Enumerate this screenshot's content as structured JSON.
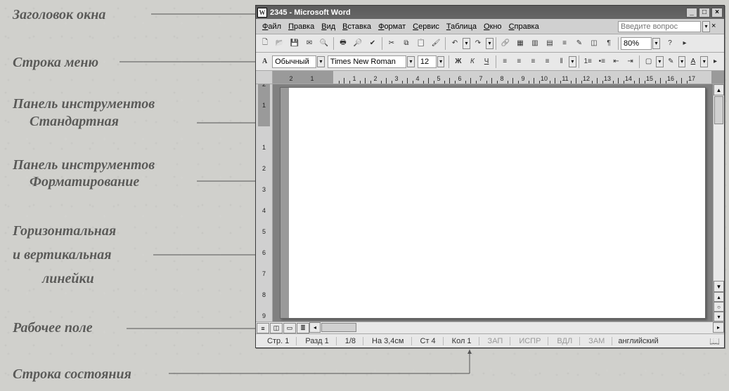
{
  "labels": {
    "title": "Заголовок окна",
    "menu": "Строка меню",
    "toolbar_std_1": "Панель инструментов",
    "toolbar_std_2": "Стандартная",
    "toolbar_fmt_1": "Панель инструментов",
    "toolbar_fmt_2": "Форматирование",
    "rulers_1": "Горизонтальная",
    "rulers_2": "и вертикальная",
    "rulers_3": "линейки",
    "workarea": "Рабочее поле",
    "status": "Строка состояния"
  },
  "window": {
    "title": "2345 - Microsoft Word",
    "app_icon_letter": "W"
  },
  "menu": {
    "items": [
      "Файл",
      "Правка",
      "Вид",
      "Вставка",
      "Формат",
      "Сервис",
      "Таблица",
      "Окно",
      "Справка"
    ],
    "ask_placeholder": "Введите вопрос"
  },
  "toolbar_std": {
    "zoom": "80%",
    "icons": [
      "new",
      "open",
      "save",
      "mail",
      "search",
      "print",
      "preview",
      "spell",
      "cut",
      "copy",
      "paste",
      "format-painter",
      "undo",
      "redo",
      "link",
      "table-border",
      "tables",
      "excel",
      "columns",
      "drawing",
      "doc-map",
      "pilcrow",
      "zoom",
      "help",
      "more"
    ]
  },
  "toolbar_fmt": {
    "mode_icon": "A",
    "style": "Обычный",
    "font": "Times New Roman",
    "size": "12",
    "bold": "Ж",
    "italic": "К",
    "underline": "Ч",
    "font_color_letter": "A"
  },
  "ruler": {
    "h_numbers": [
      "2",
      "1",
      "1",
      "2",
      "3",
      "4",
      "5",
      "6",
      "7",
      "8",
      "9",
      "10",
      "11",
      "12",
      "13",
      "14",
      "15",
      "16",
      "17"
    ],
    "v_numbers": [
      "2",
      "1",
      "1",
      "2",
      "3",
      "4",
      "5",
      "6",
      "7",
      "8"
    ]
  },
  "status": {
    "page": "Стр. 1",
    "section": "Разд 1",
    "pages": "1/8",
    "at": "На 3,4см",
    "line": "Ст 4",
    "col": "Кол 1",
    "flags": [
      "ЗАП",
      "ИСПР",
      "ВДЛ",
      "ЗАМ"
    ],
    "lang": "английский"
  }
}
